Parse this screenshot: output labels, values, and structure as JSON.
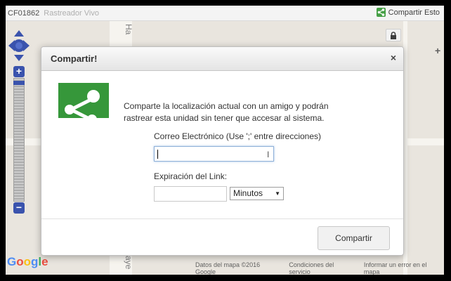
{
  "topbar": {
    "unit_id": "CF01862",
    "tracker_title": "Rastreador Vivo",
    "share_link_label": "Compartir Esto"
  },
  "map": {
    "street_top": "Ha",
    "street_bottom": "aye",
    "footer": {
      "map_data": "Datos del mapa ©2016 Google",
      "terms": "Condiciones del servicio",
      "report": "Informar un error en el mapa"
    },
    "google_logo": [
      "G",
      "o",
      "o",
      "g",
      "l",
      "e"
    ],
    "zoom_in": "+",
    "zoom_out": "−"
  },
  "modal": {
    "title": "Compartir!",
    "close": "×",
    "description_line1": "Comparte la localización actual con un amigo y podrán",
    "description_line2": "rastrear esta unidad sin tener que accesar al sistema.",
    "email_label": "Correo Electrónico (Use ';' entre direcciones)",
    "email_value": "",
    "expiration_label": "Expiración del Link:",
    "expiration_value": "",
    "expiration_unit": "Minutos",
    "submit_label": "Compartir"
  },
  "colors": {
    "share_green": "#36973a",
    "control_blue": "#2e49a8"
  }
}
